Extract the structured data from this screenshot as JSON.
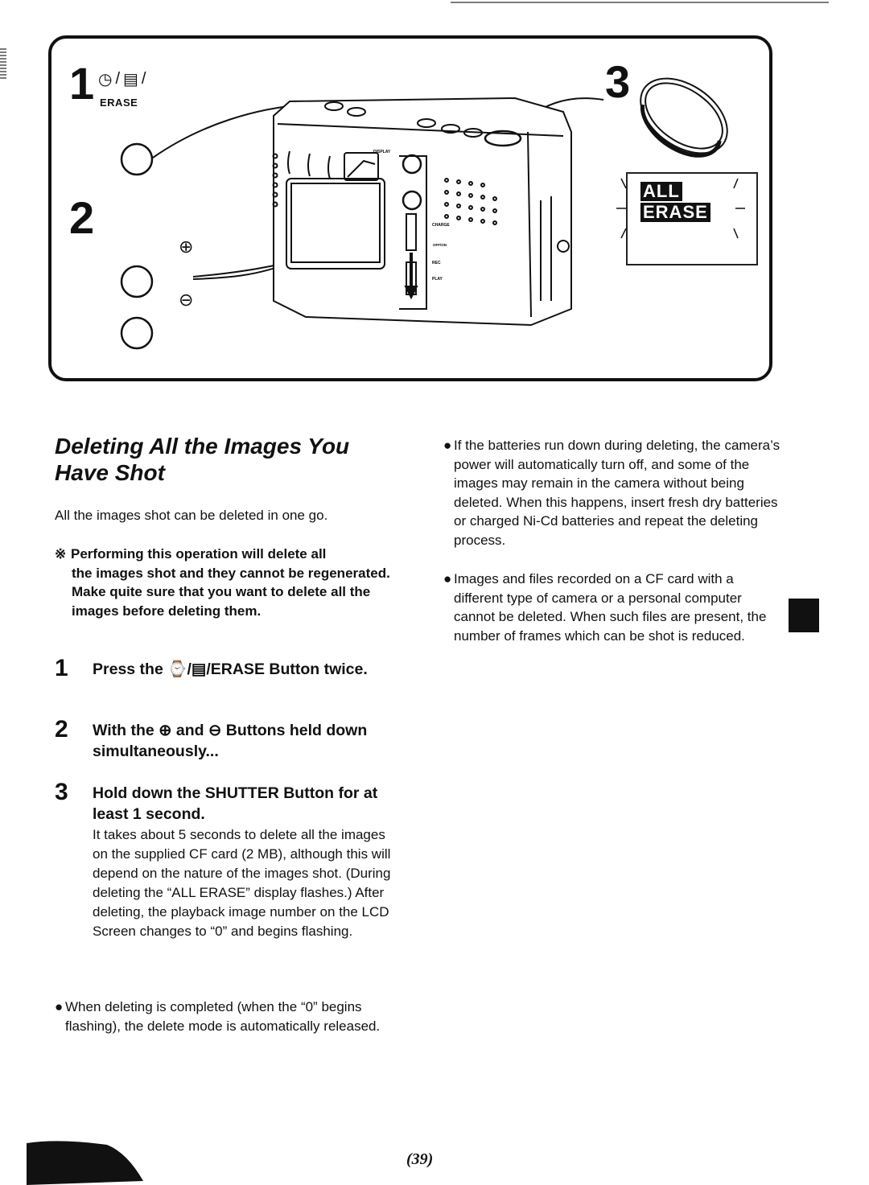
{
  "illustration": {
    "step1": {
      "number": "1",
      "button_symbols": "⌚ / ▤ /",
      "self_timer_icon": "self-timer-icon",
      "burst_icon": "burst-icon",
      "erase_label": "ERASE"
    },
    "step2": {
      "number": "2",
      "plus_symbol": "⊕",
      "minus_symbol": "⊖"
    },
    "step3": {
      "number": "3"
    },
    "lcd_display": {
      "line1": "ALL",
      "line2": "ERASE"
    },
    "camera_labels": {
      "display": "DISPLAY",
      "charge": "CHARGE",
      "off_on": "OFF/ON",
      "rec": "REC",
      "play": "PLAY"
    }
  },
  "section": {
    "title": "Deleting All the Images You Have Shot",
    "intro": "All the images shot can be deleted in one go.",
    "warning_mark": "※",
    "warning_first": "Performing this operation will delete all",
    "warning_rest": "the images shot and they cannot be regenerated. Make quite sure that you want to delete all the images before deleting them."
  },
  "steps": [
    {
      "number": "1",
      "heading_prefix": "Press the ",
      "heading_symbols": "⌚/▤/",
      "heading_suffix": "ERASE Button twice.",
      "body": ""
    },
    {
      "number": "2",
      "heading_prefix": "With the ",
      "plus": "⊕",
      "heading_mid": " and ",
      "minus": "⊖",
      "heading_suffix": " Buttons held down simultaneously...",
      "body": ""
    },
    {
      "number": "3",
      "heading": "Hold down the SHUTTER Button for at least 1 second.",
      "body": "It takes about 5 seconds to delete all the images on the supplied CF card (2 MB), although this will depend on the nature of the images shot. (During deleting the “ALL ERASE” display flashes.) After deleting, the playback image number on the LCD Screen changes to “0” and begins flashing."
    }
  ],
  "left_note": {
    "bullet": "●",
    "text": "When deleting is completed (when the “0” begins flashing), the delete mode is automatically released."
  },
  "right_notes": [
    {
      "bullet": "●",
      "text": "If the batteries run down during deleting, the camera’s power will automatically turn off, and some of the images may remain in the camera without being deleted. When this happens, insert fresh dry batteries or charged Ni-Cd batteries and repeat the deleting process."
    },
    {
      "bullet": "●",
      "text": "Images and files recorded on a CF card with a different type of camera or a personal computer cannot be deleted. When such files are present, the number of frames which can be shot is reduced."
    }
  ],
  "page_number": "(39)",
  "colors": {
    "ink": "#111111",
    "paper": "#ffffff"
  }
}
